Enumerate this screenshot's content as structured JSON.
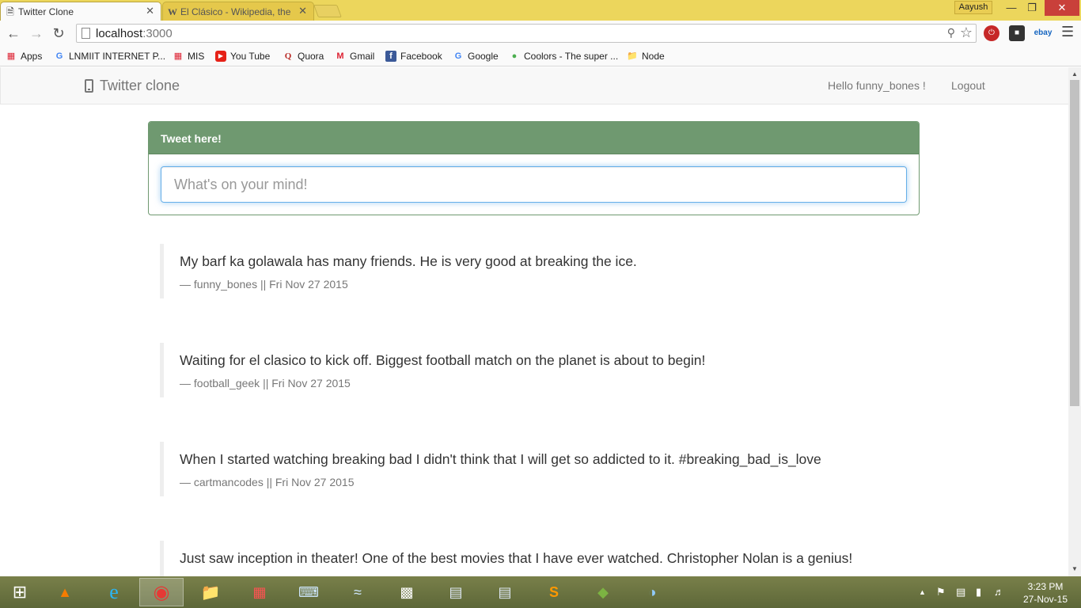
{
  "browser": {
    "tabs": [
      {
        "title": "Twitter Clone",
        "active": true
      },
      {
        "title": "El Clásico - Wikipedia, the",
        "active": false
      }
    ],
    "profile_name": "Aayush",
    "url_host": "localhost",
    "url_port": ":3000",
    "bookmarks": [
      "Apps",
      "LNMIIT INTERNET P...",
      "MIS",
      "You Tube",
      "Quora",
      "Gmail",
      "Facebook",
      "Google",
      "Coolors - The super ...",
      "Node"
    ],
    "ebay_label": "ebay"
  },
  "app": {
    "brand": "Twitter clone",
    "greeting": "Hello funny_bones !",
    "logout": "Logout",
    "composer": {
      "heading": "Tweet here!",
      "placeholder": "What's on your mind!"
    },
    "tweets": [
      {
        "text": "My barf ka golawala has many friends. He is very good at breaking the ice.",
        "meta": "— funny_bones || Fri Nov 27 2015"
      },
      {
        "text": "Waiting for el clasico to kick off. Biggest football match on the planet is about to begin!",
        "meta": "— football_geek || Fri Nov 27 2015"
      },
      {
        "text": "When I started watching breaking bad I didn't think that I will get so addicted to it. #breaking_bad_is_love",
        "meta": "— cartmancodes || Fri Nov 27 2015"
      },
      {
        "text": "Just saw inception in theater! One of the best movies that I have ever watched. Christopher Nolan is a genius!",
        "meta": ""
      }
    ]
  },
  "taskbar": {
    "time": "3:23 PM",
    "date": "27-Nov-15"
  },
  "colors": {
    "panel_accent": "#6f9970",
    "tabstrip": "#ecd65c",
    "close_button": "#c9403a"
  }
}
